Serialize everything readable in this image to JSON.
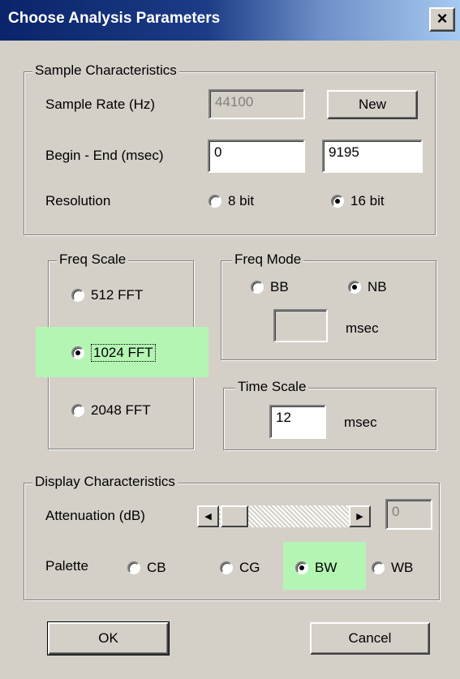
{
  "window": {
    "title": "Choose Analysis Parameters",
    "close_symbol": "×"
  },
  "sample": {
    "legend": "Sample Characteristics",
    "rate_label": "Sample Rate (Hz)",
    "rate_value": "44100",
    "new_button": "New",
    "begin_end_label": "Begin - End  (msec)",
    "begin_value": "0",
    "end_value": "9195",
    "resolution_label": "Resolution",
    "res_8": "8 bit",
    "res_16": "16 bit",
    "selected_resolution": "16 bit"
  },
  "freq_scale": {
    "legend": "Freq Scale",
    "opt_512": "512 FFT",
    "opt_1024": "1024 FFT",
    "opt_2048": "2048 FFT",
    "selected": "1024 FFT"
  },
  "freq_mode": {
    "legend": "Freq Mode",
    "bb": "BB",
    "nb": "NB",
    "selected": "NB",
    "value": "",
    "unit": "msec"
  },
  "time_scale": {
    "legend": "Time Scale",
    "value": "12",
    "unit": "msec"
  },
  "display": {
    "legend": "Display Characteristics",
    "attenuation_label": "Attenuation (dB)",
    "attenuation_value": "0",
    "palette_label": "Palette",
    "cb": "CB",
    "cg": "CG",
    "bw": "BW",
    "wb": "WB",
    "selected_palette": "BW"
  },
  "buttons": {
    "ok": "OK",
    "cancel": "Cancel"
  },
  "colors": {
    "highlight": "#b4f5b4",
    "titlebar_start": "#0a246a",
    "titlebar_end": "#a6caf0",
    "face": "#d4d0c8"
  }
}
